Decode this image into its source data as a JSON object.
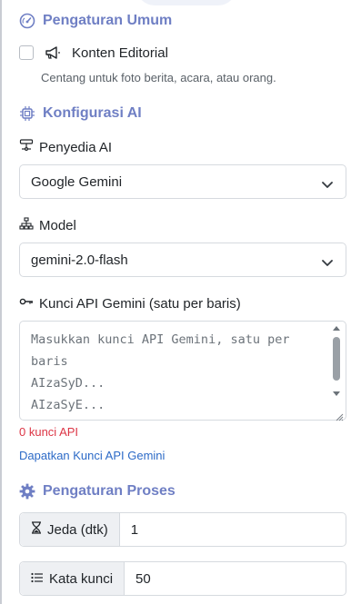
{
  "general": {
    "title": "Pengaturan Umum",
    "editorial_label": "Konten Editorial",
    "editorial_checked": false,
    "editorial_help": "Centang untuk foto berita, acara, atau orang."
  },
  "ai": {
    "title": "Konfigurasi AI",
    "provider_label": "Penyedia AI",
    "provider_value": "Google Gemini",
    "model_label": "Model",
    "model_value": "gemini-2.0-flash",
    "key_label": "Kunci API Gemini (satu per baris)",
    "key_placeholder": "Masukkan kunci API Gemini, satu per\nbaris\nAIzaSyD...\nAIzaSyE...",
    "key_count": "0 kunci API",
    "key_link": "Dapatkan Kunci API Gemini"
  },
  "process": {
    "title": "Pengaturan Proses",
    "delay_label": "Jeda (dtk)",
    "delay_value": "1",
    "keywords_label": "Kata kunci",
    "keywords_value": "50"
  },
  "colors": {
    "section_title": "#6f7fc4",
    "error": "#dc3545",
    "link": "#2c6ac7"
  }
}
